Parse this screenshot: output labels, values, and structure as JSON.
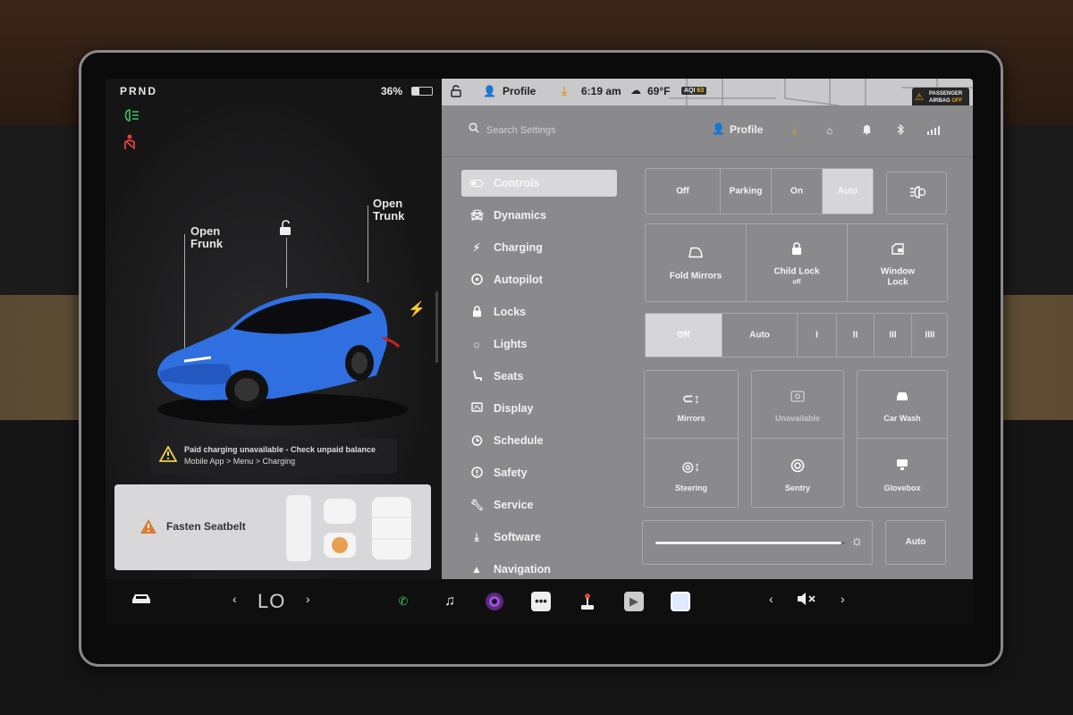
{
  "status": {
    "gear": "PRND",
    "battery_percent": "36%",
    "battery_level": 0.36
  },
  "left_panel": {
    "callout_frunk": "Open\nFrunk",
    "callout_trunk": "Open\nTrunk",
    "alert_charging_line1": "Paid charging unavailable - Check unpaid balance",
    "alert_charging_line2": "Mobile App > Menu > Charging",
    "seatbelt_alert": "Fasten Seatbelt"
  },
  "top_bar": {
    "profile": "Profile",
    "time": "6:19 am",
    "temperature": "69°F",
    "aqi_label": "AQI",
    "aqi_value": "63",
    "airbag_line1": "PASSENGER",
    "airbag_line2": "AIRBAG",
    "airbag_state": "OFF"
  },
  "settings_header": {
    "search_placeholder": "Search Settings",
    "profile": "Profile"
  },
  "nav": {
    "items": [
      {
        "label": "Controls",
        "icon": "toggle-icon"
      },
      {
        "label": "Dynamics",
        "icon": "car-icon"
      },
      {
        "label": "Charging",
        "icon": "bolt-icon"
      },
      {
        "label": "Autopilot",
        "icon": "steering-wheel-icon"
      },
      {
        "label": "Locks",
        "icon": "lock-icon"
      },
      {
        "label": "Lights",
        "icon": "sun-icon"
      },
      {
        "label": "Seats",
        "icon": "seat-icon"
      },
      {
        "label": "Display",
        "icon": "display-icon"
      },
      {
        "label": "Schedule",
        "icon": "clock-icon"
      },
      {
        "label": "Safety",
        "icon": "info-icon"
      },
      {
        "label": "Service",
        "icon": "wrench-icon"
      },
      {
        "label": "Software",
        "icon": "download-icon"
      },
      {
        "label": "Navigation",
        "icon": "navigation-icon"
      }
    ],
    "active": "Controls"
  },
  "controls": {
    "lights": {
      "options": [
        "Off",
        "Parking",
        "On",
        "Auto"
      ],
      "selected": "Auto"
    },
    "fold_mirrors": "Fold Mirrors",
    "child_lock": "Child Lock",
    "child_lock_state": "off",
    "window_lock_l1": "Window",
    "window_lock_l2": "Lock",
    "wipers": {
      "options": [
        "Off",
        "Auto",
        "I",
        "II",
        "III",
        "IIII"
      ],
      "selected": "Off"
    },
    "mirrors": "Mirrors",
    "unavailable": "Unavailable",
    "car_wash": "Car Wash",
    "steering": "Steering",
    "sentry": "Sentry",
    "glovebox": "Glovebox",
    "brightness_auto": "Auto",
    "brightness_level": 0.98
  },
  "bottom_bar": {
    "climate_temp": "LO",
    "prev": "‹",
    "next": "›"
  },
  "colors": {
    "active_nav_bg": "#d8d8da",
    "panel_bg": "#8a8a8c",
    "car_blue": "#2f6fe0",
    "warning_orange": "#e07a30",
    "download_yellow": "#d4a020"
  }
}
